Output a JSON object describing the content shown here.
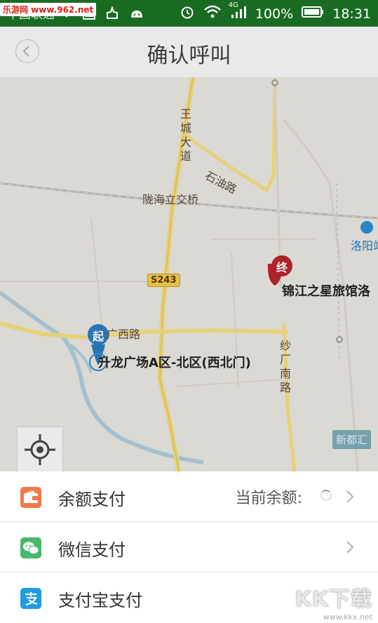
{
  "status_bar": {
    "carrier": "中国联通",
    "network": "4G",
    "battery": "100%",
    "time": "18:31",
    "watermark": "乐游网 www.962.net"
  },
  "header": {
    "title": "确认呼叫"
  },
  "map": {
    "roads": {
      "wangcheng_avenue": [
        "王",
        "城",
        "大",
        "道"
      ],
      "shiyou_road": "石油路",
      "longhai_bridge": "陇海立交桥",
      "shachang_south": [
        "纱",
        "厂",
        "南",
        "路"
      ],
      "guangxi_road": "广西路"
    },
    "highway_badge": "S243",
    "station": "洛阳站",
    "metro_badge": "新都汇",
    "start_marker": "起",
    "end_marker": "终",
    "start_poi": "升龙广场A区-北区(西北门)",
    "end_poi": "锦江之星旅馆洛"
  },
  "payment": {
    "rows": [
      {
        "label": "余额支付",
        "extra": "当前余额:"
      },
      {
        "label": "微信支付"
      },
      {
        "label": "支付宝支付"
      }
    ]
  },
  "watermark_br": {
    "big": "KK下载",
    "small": "www.kkx.net"
  }
}
